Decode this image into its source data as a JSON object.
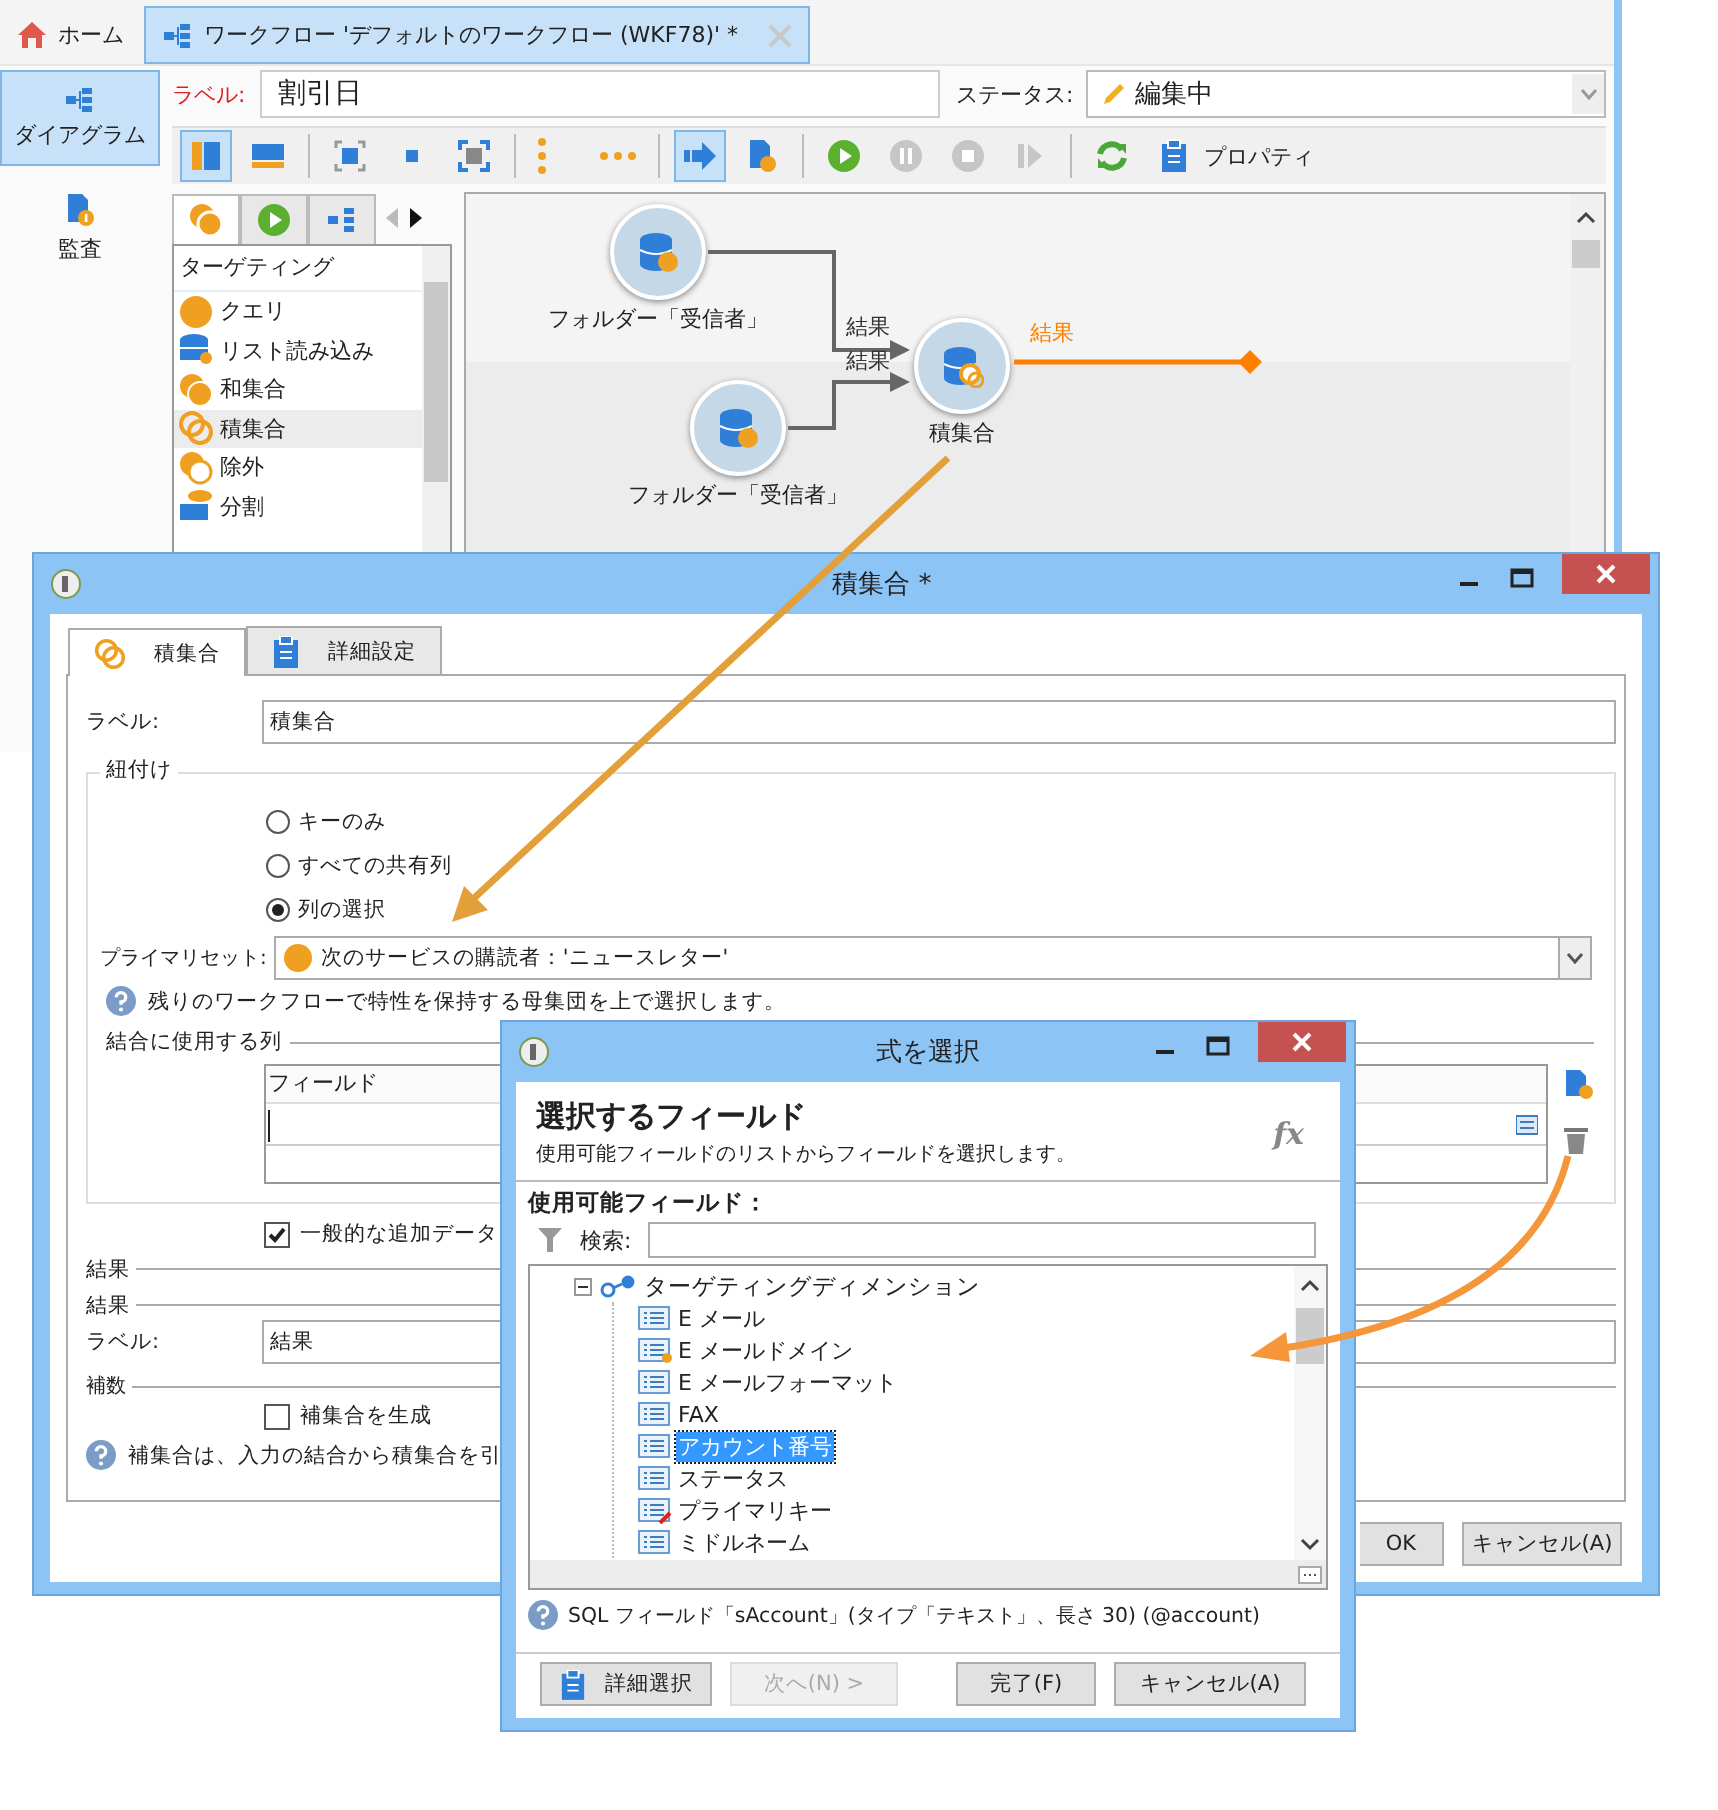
{
  "main_window": {
    "tabs": [
      {
        "kind": "home",
        "label": "ホーム",
        "selected": false
      },
      {
        "kind": "workflow",
        "label": "ワークフロー 'デフォルトのワークフロー (WKF78)' *",
        "selected": true
      }
    ],
    "sidebar": [
      {
        "kind": "diagram",
        "label": "ダイアグラム",
        "selected": true
      },
      {
        "kind": "audit",
        "label": "監査",
        "selected": false
      }
    ],
    "label_field": {
      "label": "ラベル:",
      "value": "割引日"
    },
    "status_field": {
      "label": "ステータス:",
      "value": "編集中"
    },
    "toolbar": [
      [
        {
          "kind": "panel-left",
          "selected": true,
          "disabled": false
        },
        {
          "kind": "panel-bottom",
          "selected": false,
          "disabled": false
        }
      ],
      [
        {
          "kind": "fit",
          "selected": false,
          "disabled": false
        },
        {
          "kind": "center",
          "selected": false,
          "disabled": false
        },
        {
          "kind": "zoom",
          "selected": false,
          "disabled": false
        }
      ],
      [
        {
          "kind": "dots-vertical",
          "selected": false,
          "disabled": false
        },
        {
          "kind": "dots-horizontal",
          "selected": false,
          "disabled": false
        }
      ],
      [
        {
          "kind": "flow",
          "selected": true,
          "disabled": false
        },
        {
          "kind": "audit",
          "selected": false,
          "disabled": false
        }
      ],
      [
        {
          "kind": "play",
          "selected": false,
          "disabled": false
        },
        {
          "kind": "pause",
          "selected": false,
          "disabled": true
        },
        {
          "kind": "stop",
          "selected": false,
          "disabled": true
        },
        {
          "kind": "step",
          "selected": false,
          "disabled": true
        }
      ],
      [
        {
          "kind": "refresh",
          "selected": false,
          "disabled": false
        },
        {
          "kind": "properties",
          "label": "プロパティ",
          "selected": false,
          "disabled": false
        }
      ]
    ],
    "palette": {
      "tabs": [
        {
          "kind": "targeting",
          "selected": true
        },
        {
          "kind": "flow",
          "selected": false
        },
        {
          "kind": "tools",
          "selected": false
        }
      ],
      "header": "ターゲティング",
      "items": [
        {
          "kind": "query",
          "label": "クエリ",
          "selected": false
        },
        {
          "kind": "list",
          "label": "リスト読み込み",
          "selected": false
        },
        {
          "kind": "union",
          "label": "和集合",
          "selected": false
        },
        {
          "kind": "intersection",
          "label": "積集合",
          "selected": true
        },
        {
          "kind": "exclusion",
          "label": "除外",
          "selected": false
        },
        {
          "kind": "split",
          "label": "分割",
          "selected": false
        }
      ]
    },
    "canvas": {
      "nodes": [
        {
          "kind": "folder",
          "label": "フォルダー「受信者」"
        },
        {
          "kind": "folder",
          "label": "フォルダー「受信者」"
        },
        {
          "kind": "intersection",
          "label": "積集合"
        }
      ],
      "edges": [
        {
          "kind": "input",
          "label": "結果"
        },
        {
          "kind": "input",
          "label": "結果"
        },
        {
          "kind": "output",
          "label": "結果"
        }
      ]
    }
  },
  "dialog": {
    "title": "積集合 *",
    "tabs": [
      {
        "kind": "intersection",
        "label": "積集合",
        "selected": true
      },
      {
        "kind": "advanced",
        "label": "詳細設定",
        "selected": false
      }
    ],
    "label_field": {
      "label": "ラベル:",
      "value": "積集合"
    },
    "reconciliation": {
      "title": "紐付け",
      "options": [
        {
          "label": "キーのみ",
          "selected": false
        },
        {
          "label": "すべての共有列",
          "selected": false
        },
        {
          "label": "列の選択",
          "selected": true
        }
      ],
      "primary_set": {
        "label": "プライマリセット:",
        "value": "次のサービスの購読者：'ニュースレター'"
      },
      "help": "残りのワークフローで特性を保持する母集団を上で選択します。",
      "columns": {
        "title": "結合に使用する列",
        "header": "フィールド"
      }
    },
    "extra_data": {
      "label": "一般的な追加データ",
      "checked": true
    },
    "result_sections": [
      "結果",
      "結果"
    ],
    "result_label": {
      "label": "ラベル:",
      "value": "結果"
    },
    "complement": {
      "title": "補数",
      "option": {
        "label": "補集合を生成",
        "checked": false
      },
      "help": "補集合は、入力の結合から積集合を引"
    },
    "buttons": [
      "OK",
      "キャンセル(A)"
    ]
  },
  "picker": {
    "title": "式を選択",
    "heading": "選択するフィールド",
    "subtitle": "使用可能フィールドのリストからフィールドを選択します。",
    "fx": "fx",
    "fields_label": "使用可能フィールド：",
    "search_label": "検索:",
    "tree": {
      "label": "ターゲティングディメンション",
      "expanded": true,
      "children": [
        {
          "kind": "field",
          "label": "E メール",
          "selected": false
        },
        {
          "kind": "computed",
          "label": "E メールドメイン",
          "selected": false
        },
        {
          "kind": "field",
          "label": "E メールフォーマット",
          "selected": false
        },
        {
          "kind": "field",
          "label": "FAX",
          "selected": false
        },
        {
          "kind": "field",
          "label": "アカウント番号",
          "selected": true
        },
        {
          "kind": "field",
          "label": "ステータス",
          "selected": false
        },
        {
          "kind": "key",
          "label": "プライマリキー",
          "selected": false
        },
        {
          "kind": "field",
          "label": "ミドルネーム",
          "selected": false
        }
      ]
    },
    "help": "SQL フィールド「sAccount」(タイプ「テキスト」、長さ 30) (@account)",
    "buttons": [
      {
        "kind": "advanced",
        "label": "詳細選択",
        "disabled": false
      },
      {
        "kind": "plain",
        "label": "次へ(N) >",
        "disabled": true
      },
      {
        "kind": "plain",
        "label": "完了(F)",
        "disabled": false
      },
      {
        "kind": "plain",
        "label": "キャンセル(A)",
        "disabled": false
      }
    ]
  }
}
